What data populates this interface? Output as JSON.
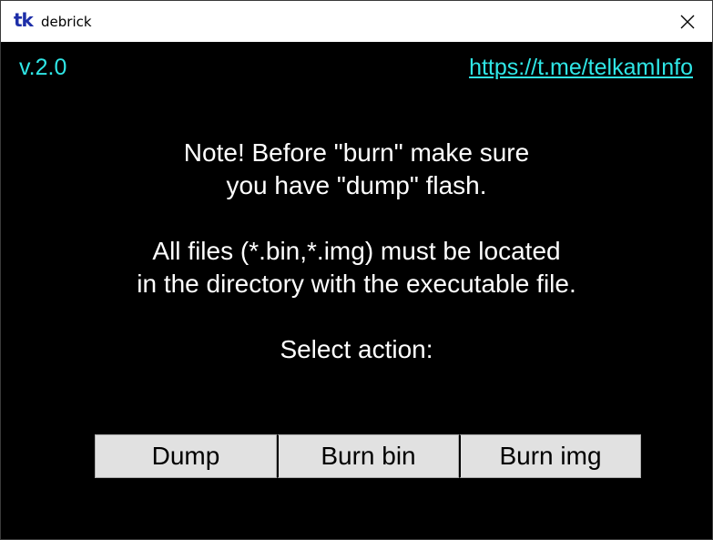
{
  "window": {
    "logo_text": "tk",
    "title": "debrick"
  },
  "header": {
    "version": "v.2.0",
    "link": "https://t.me/telkamInfo"
  },
  "notes": {
    "line1": "Note! Before \"burn\" make sure",
    "line2": "you have \"dump\" flash.",
    "line3": "All files (*.bin,*.img) must be located",
    "line4": "in the directory with the executable file.",
    "line5": "Select action:"
  },
  "actions": {
    "dump": "Dump",
    "burn_bin": "Burn bin",
    "burn_img": "Burn img"
  },
  "colors": {
    "background": "#000000",
    "accent": "#2fe6e6",
    "text": "#ffffff",
    "button_face": "#e1e1e1",
    "logo": "#1d2ea8"
  },
  "icons": {
    "close": "close-icon"
  }
}
